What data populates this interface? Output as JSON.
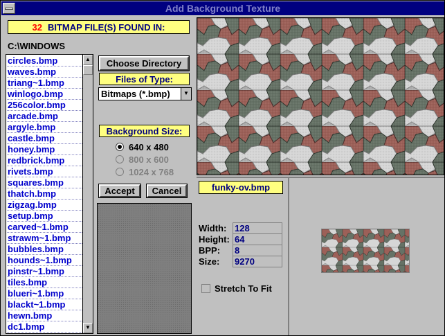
{
  "window": {
    "title": "Add Background Texture"
  },
  "header": {
    "count": "32",
    "found_text": "BITMAP FILE(S) FOUND IN:"
  },
  "path": "C:\\WINDOWS",
  "files": [
    "circles.bmp",
    "waves.bmp",
    "triang~1.bmp",
    "winlogo.bmp",
    "256color.bmp",
    "arcade.bmp",
    "argyle.bmp",
    "castle.bmp",
    "honey.bmp",
    "redbrick.bmp",
    "rivets.bmp",
    "squares.bmp",
    "thatch.bmp",
    "zigzag.bmp",
    "setup.bmp",
    "carved~1.bmp",
    "strawm~1.bmp",
    "bubbles.bmp",
    "hounds~1.bmp",
    "pinstr~1.bmp",
    "tiles.bmp",
    "blueri~1.bmp",
    "blackt~1.bmp",
    "hewn.bmp",
    "dc1.bmp"
  ],
  "controls": {
    "choose_dir": "Choose Directory",
    "files_type_label": "Files of Type:",
    "file_type_value": "Bitmaps (*.bmp)",
    "bg_size_label": "Background Size:",
    "sizes": [
      "640 x 480",
      "800 x 600",
      "1024 x 768"
    ],
    "accept": "Accept",
    "cancel": "Cancel"
  },
  "preview": {
    "filename": "funky-ov.bmp",
    "width_label": "Width:",
    "width": "128",
    "height_label": "Height:",
    "height": "64",
    "bpp_label": "BPP:",
    "bpp": "8",
    "size_label": "Size:",
    "size": "9270",
    "stretch_label": "Stretch To Fit"
  },
  "colors": {
    "title_bar": "#000080",
    "label_bg": "#ffff80",
    "list_text": "#0000cc",
    "tile_red": "#9c6058",
    "tile_green": "#667266",
    "tile_white": "#d6d6d6"
  }
}
